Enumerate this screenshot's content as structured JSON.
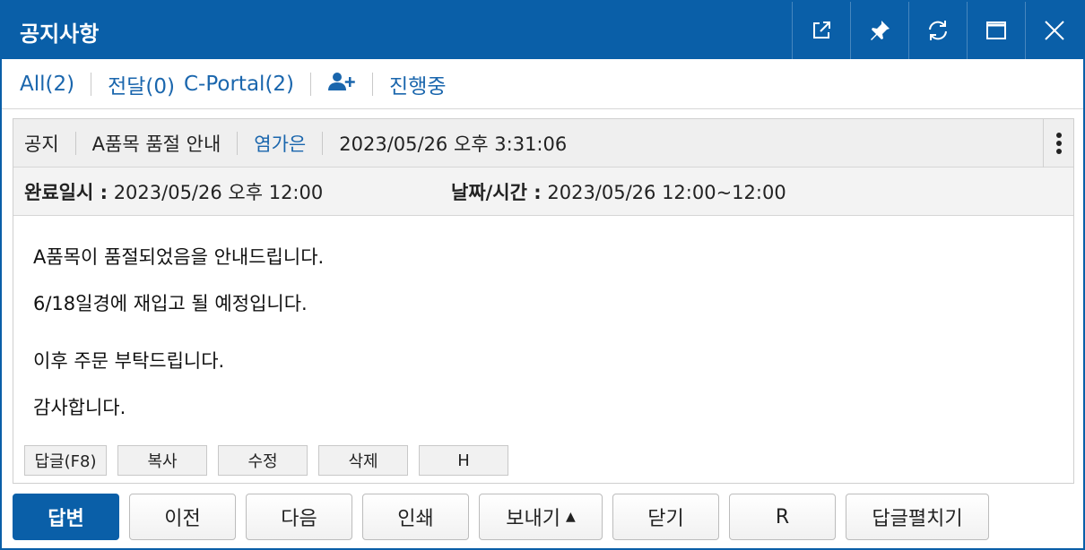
{
  "window": {
    "title": "공지사항"
  },
  "titlebar_buttons": [
    "external-link-icon",
    "pin-icon",
    "refresh-icon",
    "maximize-icon",
    "close-icon"
  ],
  "filters": {
    "all": "All(2)",
    "deliver": "전달(0)",
    "cportal": "C-Portal(2)",
    "status": "진행중"
  },
  "notice": {
    "type": "공지",
    "subject": "A품목 품절 안내",
    "author": "염가은",
    "datetime": "2023/05/26 오후 3:31:06",
    "completion_label": "완료일시 :",
    "completion_value": "2023/05/26 오후 12:00",
    "schedule_label": "날짜/시간 :",
    "schedule_value": "2023/05/26 12:00~12:00",
    "body_lines": [
      "A품목이 품절되었음을 안내드립니다.",
      "6/18일경에 재입고 될 예정입니다.",
      "이후 주문 부탁드립니다.",
      "감사합니다."
    ]
  },
  "mini_actions": [
    "답글(F8)",
    "복사",
    "수정",
    "삭제",
    "H"
  ],
  "bottom_actions": {
    "reply": "답변",
    "prev": "이전",
    "next": "다음",
    "print": "인쇄",
    "send": "보내기",
    "close": "닫기",
    "r": "R",
    "expand_replies": "답글펼치기"
  },
  "colors": {
    "accent": "#0a5fa8",
    "link": "#1a66ad"
  }
}
